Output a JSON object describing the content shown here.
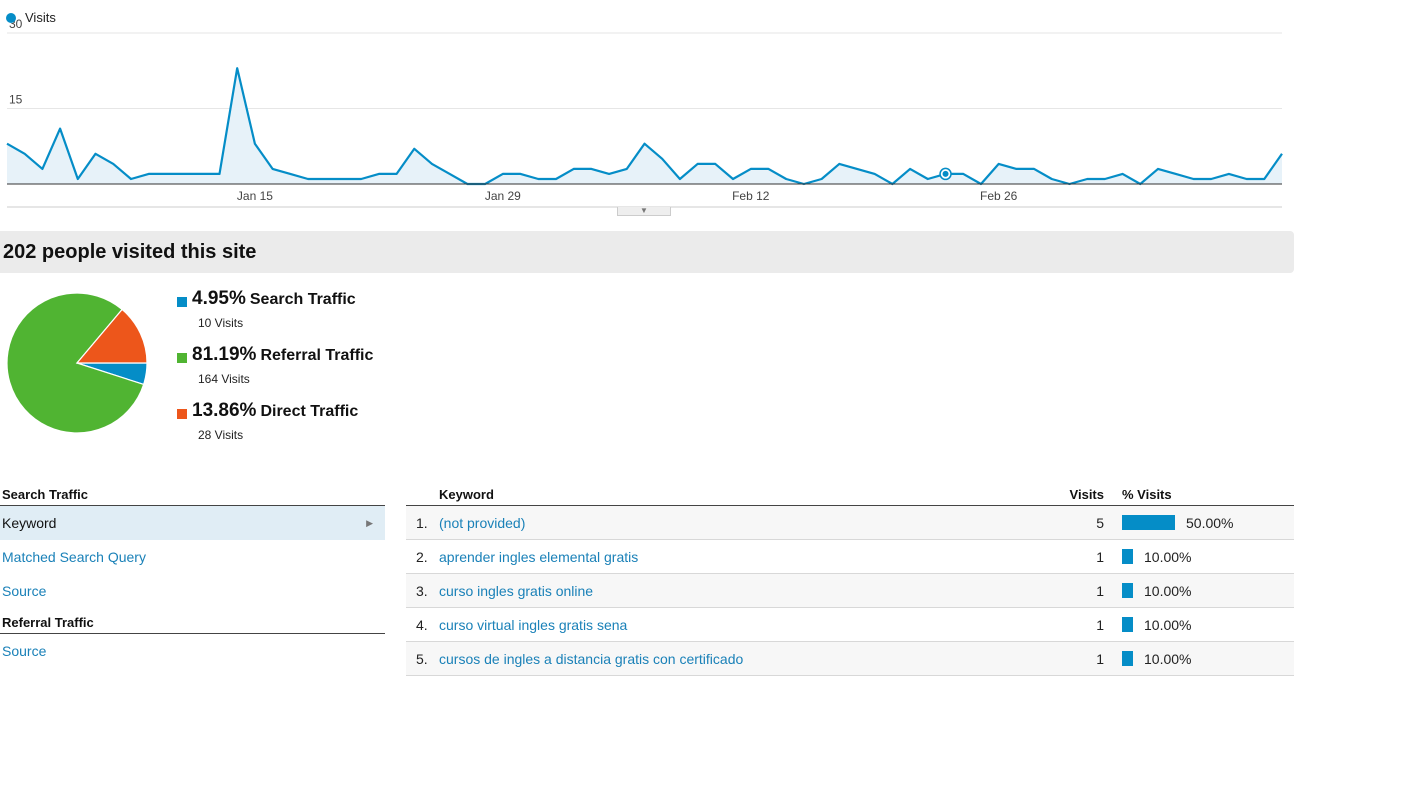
{
  "chart_data": {
    "type": "area",
    "series": [
      {
        "name": "Visits",
        "values": [
          8,
          6,
          3,
          11,
          1,
          6,
          4,
          1,
          2,
          2,
          2,
          2,
          2,
          23,
          8,
          3,
          2,
          1,
          1,
          1,
          1,
          2,
          2,
          7,
          4,
          2,
          0,
          0,
          2,
          2,
          1,
          1,
          3,
          3,
          2,
          3,
          8,
          5,
          1,
          4,
          4,
          1,
          3,
          3,
          1,
          0,
          1,
          4,
          3,
          2,
          0,
          3,
          1,
          2,
          2,
          0,
          4,
          3,
          3,
          1,
          0,
          1,
          1,
          2,
          0,
          3,
          2,
          1,
          1,
          2,
          1,
          1,
          6
        ]
      }
    ],
    "x_tick_labels": [
      "Jan 15",
      "Jan 29",
      "Feb 12",
      "Feb 26"
    ],
    "y_tick_labels": [
      "30",
      "15"
    ],
    "ylim": [
      0,
      30
    ],
    "highlight_index": 53,
    "line_color": "#058dc7",
    "fill_color": "#e7f2f9"
  },
  "summary": {
    "title": "202 people visited this site"
  },
  "pie": {
    "slices": [
      {
        "percent": "4.95%",
        "name": "Search Traffic",
        "visits": "10 Visits",
        "value": 4.95,
        "color": "#058dc7"
      },
      {
        "percent": "81.19%",
        "name": "Referral Traffic",
        "visits": "164 Visits",
        "value": 81.19,
        "color": "#50b432"
      },
      {
        "percent": "13.86%",
        "name": "Direct Traffic",
        "visits": "28 Visits",
        "value": 13.86,
        "color": "#ed561b"
      }
    ]
  },
  "nav": {
    "search_heading": "Search Traffic",
    "search_items": [
      "Keyword",
      "Matched Search Query",
      "Source"
    ],
    "referral_heading": "Referral Traffic",
    "referral_items": [
      "Source"
    ]
  },
  "table": {
    "headers": {
      "keyword": "Keyword",
      "visits": "Visits",
      "pct": "% Visits"
    },
    "rows": [
      {
        "idx": "1.",
        "keyword": "(not provided)",
        "visits": "5",
        "pct": "50.00%",
        "share": 0.5
      },
      {
        "idx": "2.",
        "keyword": "aprender ingles elemental gratis",
        "visits": "1",
        "pct": "10.00%",
        "share": 0.1
      },
      {
        "idx": "3.",
        "keyword": "curso ingles gratis online",
        "visits": "1",
        "pct": "10.00%",
        "share": 0.1
      },
      {
        "idx": "4.",
        "keyword": "curso virtual ingles gratis sena",
        "visits": "1",
        "pct": "10.00%",
        "share": 0.1
      },
      {
        "idx": "5.",
        "keyword": "cursos de ingles a distancia gratis con certificado",
        "visits": "1",
        "pct": "10.00%",
        "share": 0.1
      }
    ],
    "bar_color": "#058dc7"
  }
}
